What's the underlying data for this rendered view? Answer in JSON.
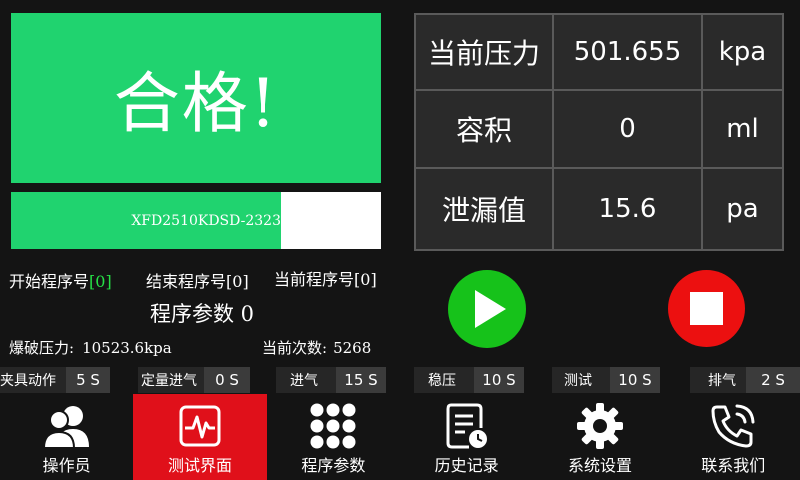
{
  "status": {
    "pass_text": "合格!",
    "pass_color": "#20d36f"
  },
  "barcode": {
    "text": "XFD2510KDSD-2323",
    "fill_fraction": 0.73
  },
  "program": {
    "start_label": "开始程序号",
    "start_value": "[0]",
    "end_label": "结束程序号",
    "end_value": "[0]",
    "current_label": "当前程序号",
    "current_value": "[0]",
    "params_label": "程序参数 0"
  },
  "stats": {
    "burst_label": "爆破压力:",
    "burst_value": "10523.6kpa",
    "count_label": "当前次数:",
    "count_value": "5268"
  },
  "readings": [
    {
      "label": "当前压力",
      "value": "501.655",
      "unit": "kpa"
    },
    {
      "label": "容积",
      "value": "0",
      "unit": "ml"
    },
    {
      "label": "泄漏值",
      "value": "15.6",
      "unit": "pa"
    }
  ],
  "controls": {
    "start_color": "#16c21a",
    "stop_color": "#ec1010"
  },
  "timers": [
    {
      "label": "夹具动作",
      "value": "5 S"
    },
    {
      "label": "定量进气",
      "value": "0 S"
    },
    {
      "label": "进气",
      "value": "15 S"
    },
    {
      "label": "稳压",
      "value": "10 S"
    },
    {
      "label": "测试",
      "value": "10 S"
    },
    {
      "label": "排气",
      "value": "2 S"
    }
  ],
  "nav": [
    {
      "label": "操作员",
      "icon": "users-icon"
    },
    {
      "label": "测试界面",
      "icon": "heartbeat-monitor-icon",
      "active": true
    },
    {
      "label": "程序参数",
      "icon": "dots-grid-icon"
    },
    {
      "label": "历史记录",
      "icon": "history-document-icon"
    },
    {
      "label": "系统设置",
      "icon": "gear-icon"
    },
    {
      "label": "联系我们",
      "icon": "phone-icon"
    }
  ]
}
